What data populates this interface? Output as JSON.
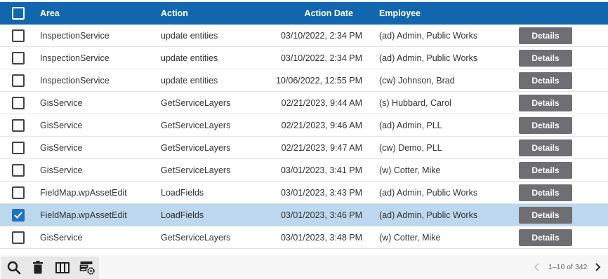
{
  "header": {
    "area_label": "Area",
    "action_label": "Action",
    "date_label": "Action Date",
    "employee_label": "Employee"
  },
  "rows": [
    {
      "area": "InspectionService",
      "action": "update entities",
      "date": "03/10/2022, 2:34 PM",
      "employee": "(ad) Admin, Public Works",
      "button": "Details",
      "checked": false
    },
    {
      "area": "InspectionService",
      "action": "update entities",
      "date": "03/10/2022, 2:34 PM",
      "employee": "(ad) Admin, Public Works",
      "button": "Details",
      "checked": false
    },
    {
      "area": "InspectionService",
      "action": "update entities",
      "date": "10/06/2022, 12:55 PM",
      "employee": "(cw) Johnson, Brad",
      "button": "Details",
      "checked": false
    },
    {
      "area": "GisService",
      "action": "GetServiceLayers",
      "date": "02/21/2023, 9:44 AM",
      "employee": "(s) Hubbard, Carol",
      "button": "Details",
      "checked": false
    },
    {
      "area": "GisService",
      "action": "GetServiceLayers",
      "date": "02/21/2023, 9:46 AM",
      "employee": "(ad) Admin, PLL",
      "button": "Details",
      "checked": false
    },
    {
      "area": "GisService",
      "action": "GetServiceLayers",
      "date": "02/21/2023, 9:47 AM",
      "employee": "(cw) Demo, PLL",
      "button": "Details",
      "checked": false
    },
    {
      "area": "GisService",
      "action": "GetServiceLayers",
      "date": "03/01/2023, 3:41 PM",
      "employee": "(w) Cotter, Mike",
      "button": "Details",
      "checked": false
    },
    {
      "area": "FieldMap.wpAssetEdit",
      "action": "LoadFields",
      "date": "03/01/2023, 3:43 PM",
      "employee": "(ad) Admin, Public Works",
      "button": "Details",
      "checked": false
    },
    {
      "area": "FieldMap.wpAssetEdit",
      "action": "LoadFields",
      "date": "03/01/2023, 3:46 PM",
      "employee": "(ad) Admin, Public Works",
      "button": "Details",
      "checked": true
    },
    {
      "area": "GisService",
      "action": "GetServiceLayers",
      "date": "03/01/2023, 3:48 PM",
      "employee": "(w) Cotter, Mike",
      "button": "Details",
      "checked": false
    }
  ],
  "toolbar": {
    "icons": [
      "search-icon",
      "trash-icon",
      "columns-icon",
      "table-settings-icon"
    ]
  },
  "pager": {
    "range_text": "1–10 of 342"
  },
  "colors": {
    "header_bg": "#1166ad",
    "selected_row": "#bcd7ee",
    "checkbox_checked": "#1f71c1",
    "button_bg": "#6f6f73"
  }
}
